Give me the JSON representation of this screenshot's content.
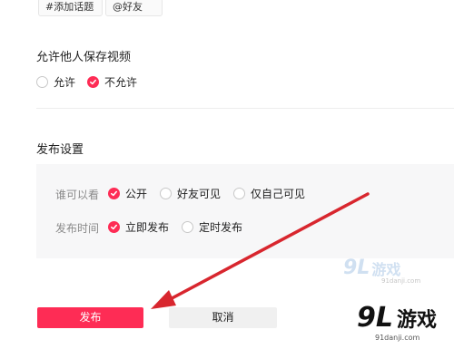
{
  "tags": {
    "topic": "#添加话题",
    "friend": "@好友"
  },
  "save_video": {
    "title": "允许他人保存视频",
    "options": [
      {
        "label": "允许",
        "checked": false
      },
      {
        "label": "不允许",
        "checked": true
      }
    ]
  },
  "publish_settings": {
    "title": "发布设置",
    "visibility": {
      "label": "谁可以看",
      "options": [
        {
          "label": "公开",
          "checked": true
        },
        {
          "label": "好友可见",
          "checked": false
        },
        {
          "label": "仅自己可见",
          "checked": false
        }
      ]
    },
    "publish_time": {
      "label": "发布时间",
      "options": [
        {
          "label": "立即发布",
          "checked": true
        },
        {
          "label": "定时发布",
          "checked": false
        }
      ]
    }
  },
  "buttons": {
    "publish": "发布",
    "cancel": "取消"
  },
  "watermarks": {
    "upper": {
      "num": "9L",
      "text": "游戏",
      "url": "91danji.com"
    },
    "lower": {
      "num": "9L",
      "text": "游戏",
      "url": "91danji.com"
    }
  },
  "colors": {
    "accent": "#fe2c55",
    "arrow": "#d8262e",
    "panel": "#f7f7f8"
  }
}
